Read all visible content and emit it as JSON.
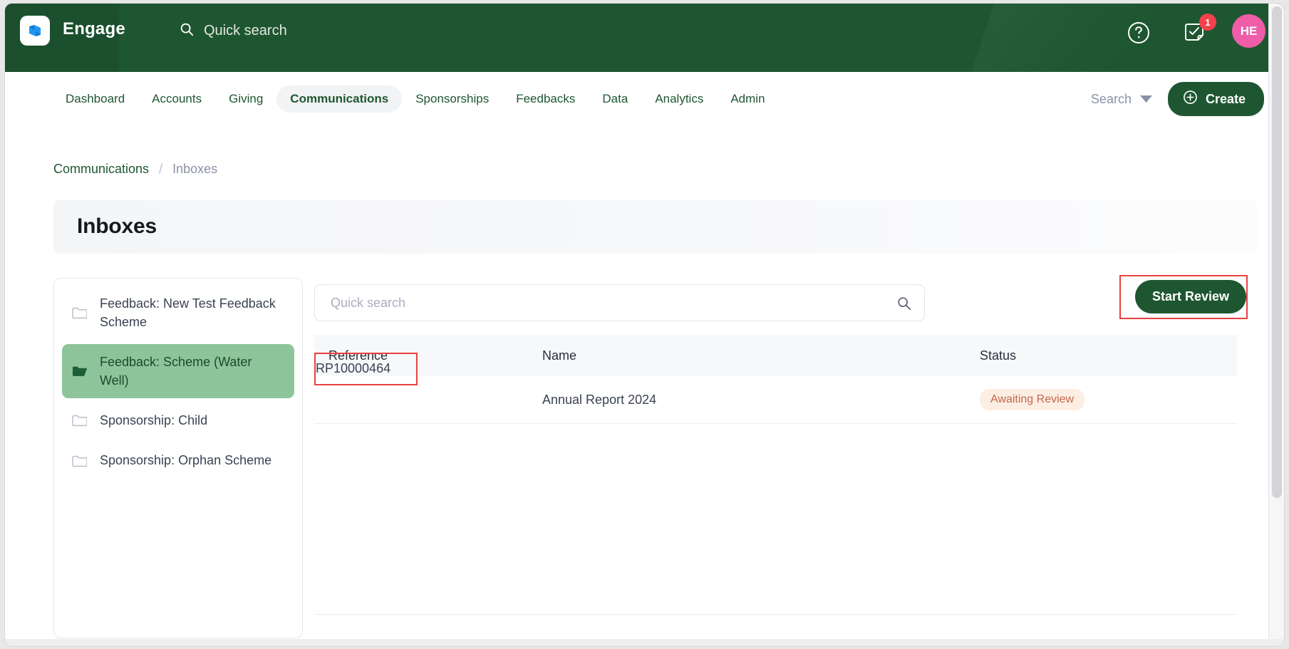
{
  "topbar": {
    "brand": "Engage",
    "quick_search_label": "Quick search",
    "logo_icon": "engage-logo-icon",
    "search_icon": "search-icon",
    "help_icon": "help-circle-icon",
    "tasks_icon": "task-checkbox-icon",
    "tasks_badge_count": "1",
    "avatar_initials": "HE",
    "bg_color": "#1e5631",
    "avatar_color": "#ef5da8",
    "badge_color": "#f4414e"
  },
  "nav": {
    "items": [
      {
        "label": "Dashboard",
        "active": false
      },
      {
        "label": "Accounts",
        "active": false
      },
      {
        "label": "Giving",
        "active": false
      },
      {
        "label": "Communications",
        "active": true
      },
      {
        "label": "Sponsorships",
        "active": false
      },
      {
        "label": "Feedbacks",
        "active": false
      },
      {
        "label": "Data",
        "active": false
      },
      {
        "label": "Analytics",
        "active": false
      },
      {
        "label": "Admin",
        "active": false
      }
    ],
    "search_dropdown_label": "Search",
    "chevron_icon": "chevron-down-icon",
    "create_label": "Create",
    "create_icon": "plus-circle-icon"
  },
  "breadcrumb": {
    "parent": "Communications",
    "separator": "/",
    "current": "Inboxes"
  },
  "page": {
    "title": "Inboxes"
  },
  "inbox_sidebar": {
    "items": [
      {
        "label": "Feedback: New Test Feedback Scheme",
        "icon": "folder-closed-icon",
        "selected": false
      },
      {
        "label": "Feedback: Scheme (Water Well)",
        "icon": "folder-open-icon",
        "selected": true
      },
      {
        "label": "Sponsorship: Child",
        "icon": "folder-closed-icon",
        "selected": false
      },
      {
        "label": "Sponsorship: Orphan Scheme",
        "icon": "folder-closed-icon",
        "selected": false
      }
    ],
    "selected_color": "#8ec49a"
  },
  "content": {
    "search_placeholder": "Quick search",
    "search_value": "",
    "search_icon": "search-icon",
    "start_review_label": "Start Review",
    "highlight_color": "#e8413f"
  },
  "table": {
    "columns": [
      "Reference",
      "Name",
      "Status"
    ],
    "rows": [
      {
        "reference": "RP10000464",
        "name": "Annual Report 2024",
        "status": "Awaiting Review",
        "status_bg": "#fdeee4",
        "status_fg": "#c4674a"
      }
    ]
  }
}
